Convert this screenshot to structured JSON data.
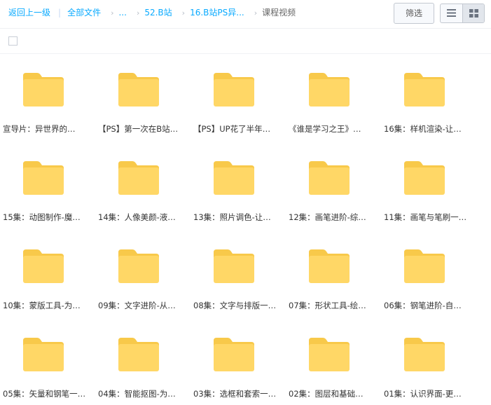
{
  "breadcrumb": {
    "back": "返回上一级",
    "separator": "|",
    "all_files": "全部文件",
    "arrow": "›",
    "ellipsis": "...",
    "level1": "52.B站",
    "level2": "16.B站PS异...",
    "current": "课程视频"
  },
  "toolbar": {
    "filter_label": "筛选",
    "list_view_icon": "list-icon",
    "grid_view_icon": "grid-icon"
  },
  "colors": {
    "link": "#09aaff",
    "folder_body": "#ffd766",
    "folder_tab": "#f8c94a"
  },
  "folders": [
    {
      "name": "宣导片：异世界的…"
    },
    {
      "name": "【PS】第一次在B站…"
    },
    {
      "name": "【PS】UP花了半年…"
    },
    {
      "name": "《谁是学习之王》…"
    },
    {
      "name": "16集：样机渲染-让…"
    },
    {
      "name": "15集：动图制作-魔…"
    },
    {
      "name": "14集：人像美颜-液…"
    },
    {
      "name": "13集：照片调色-让…"
    },
    {
      "name": "12集：画笔进阶-综…"
    },
    {
      "name": "11集：画笔与笔刷一…"
    },
    {
      "name": "10集：蒙版工具-为…"
    },
    {
      "name": "09集：文字进阶-从…"
    },
    {
      "name": "08集：文字与排版一…"
    },
    {
      "name": "07集：形状工具-绘…"
    },
    {
      "name": "06集：钢笔进阶-自…"
    },
    {
      "name": "05集：矢量和钢笔一…"
    },
    {
      "name": "04集：智能抠图-为…"
    },
    {
      "name": "03集：选框和套索一…"
    },
    {
      "name": "02集：图层和基础…"
    },
    {
      "name": "01集：认识界面-更…"
    }
  ]
}
